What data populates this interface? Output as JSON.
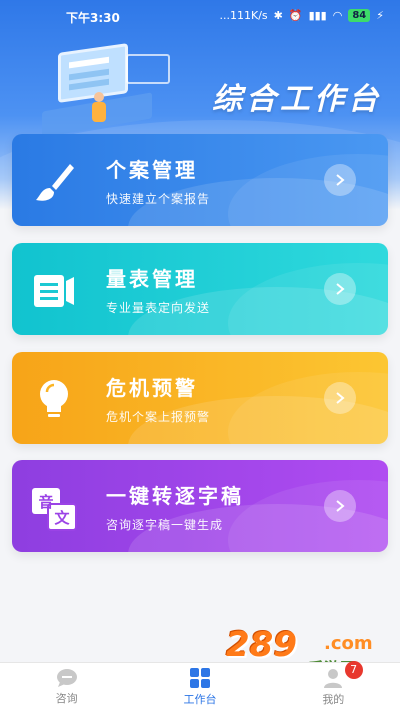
{
  "status_bar": {
    "time": "下午3:30",
    "network_speed": "...111K/s",
    "battery": "84"
  },
  "header": {
    "title": "综合工作台"
  },
  "cards": [
    {
      "title": "个案管理",
      "subtitle": "快速建立个案报告",
      "icon": "paintbrush-icon",
      "color": "#2a7ae4"
    },
    {
      "title": "量表管理",
      "subtitle": "专业量表定向发送",
      "icon": "list-document-icon",
      "color": "#11c3cf"
    },
    {
      "title": "危机预警",
      "subtitle": "危机个案上报预警",
      "icon": "lightbulb-icon",
      "color": "#f7a418"
    },
    {
      "title": "一键转逐字稿",
      "subtitle": "咨询逐字稿一键生成",
      "icon": "translate-icon",
      "color": "#9b43e6",
      "icon_text_a": "音",
      "icon_text_b": "文"
    }
  ],
  "watermark": {
    "num": "289",
    "com": ".com",
    "cn": "手游网"
  },
  "bottom_nav": [
    {
      "label": "咨询",
      "icon": "chat-icon",
      "active": false
    },
    {
      "label": "工作台",
      "icon": "grid-icon",
      "active": true
    },
    {
      "label": "我的",
      "icon": "user-icon",
      "active": false,
      "badge": "7"
    }
  ],
  "colors": {
    "accent": "#2d76e6",
    "badge": "#e8382e"
  }
}
